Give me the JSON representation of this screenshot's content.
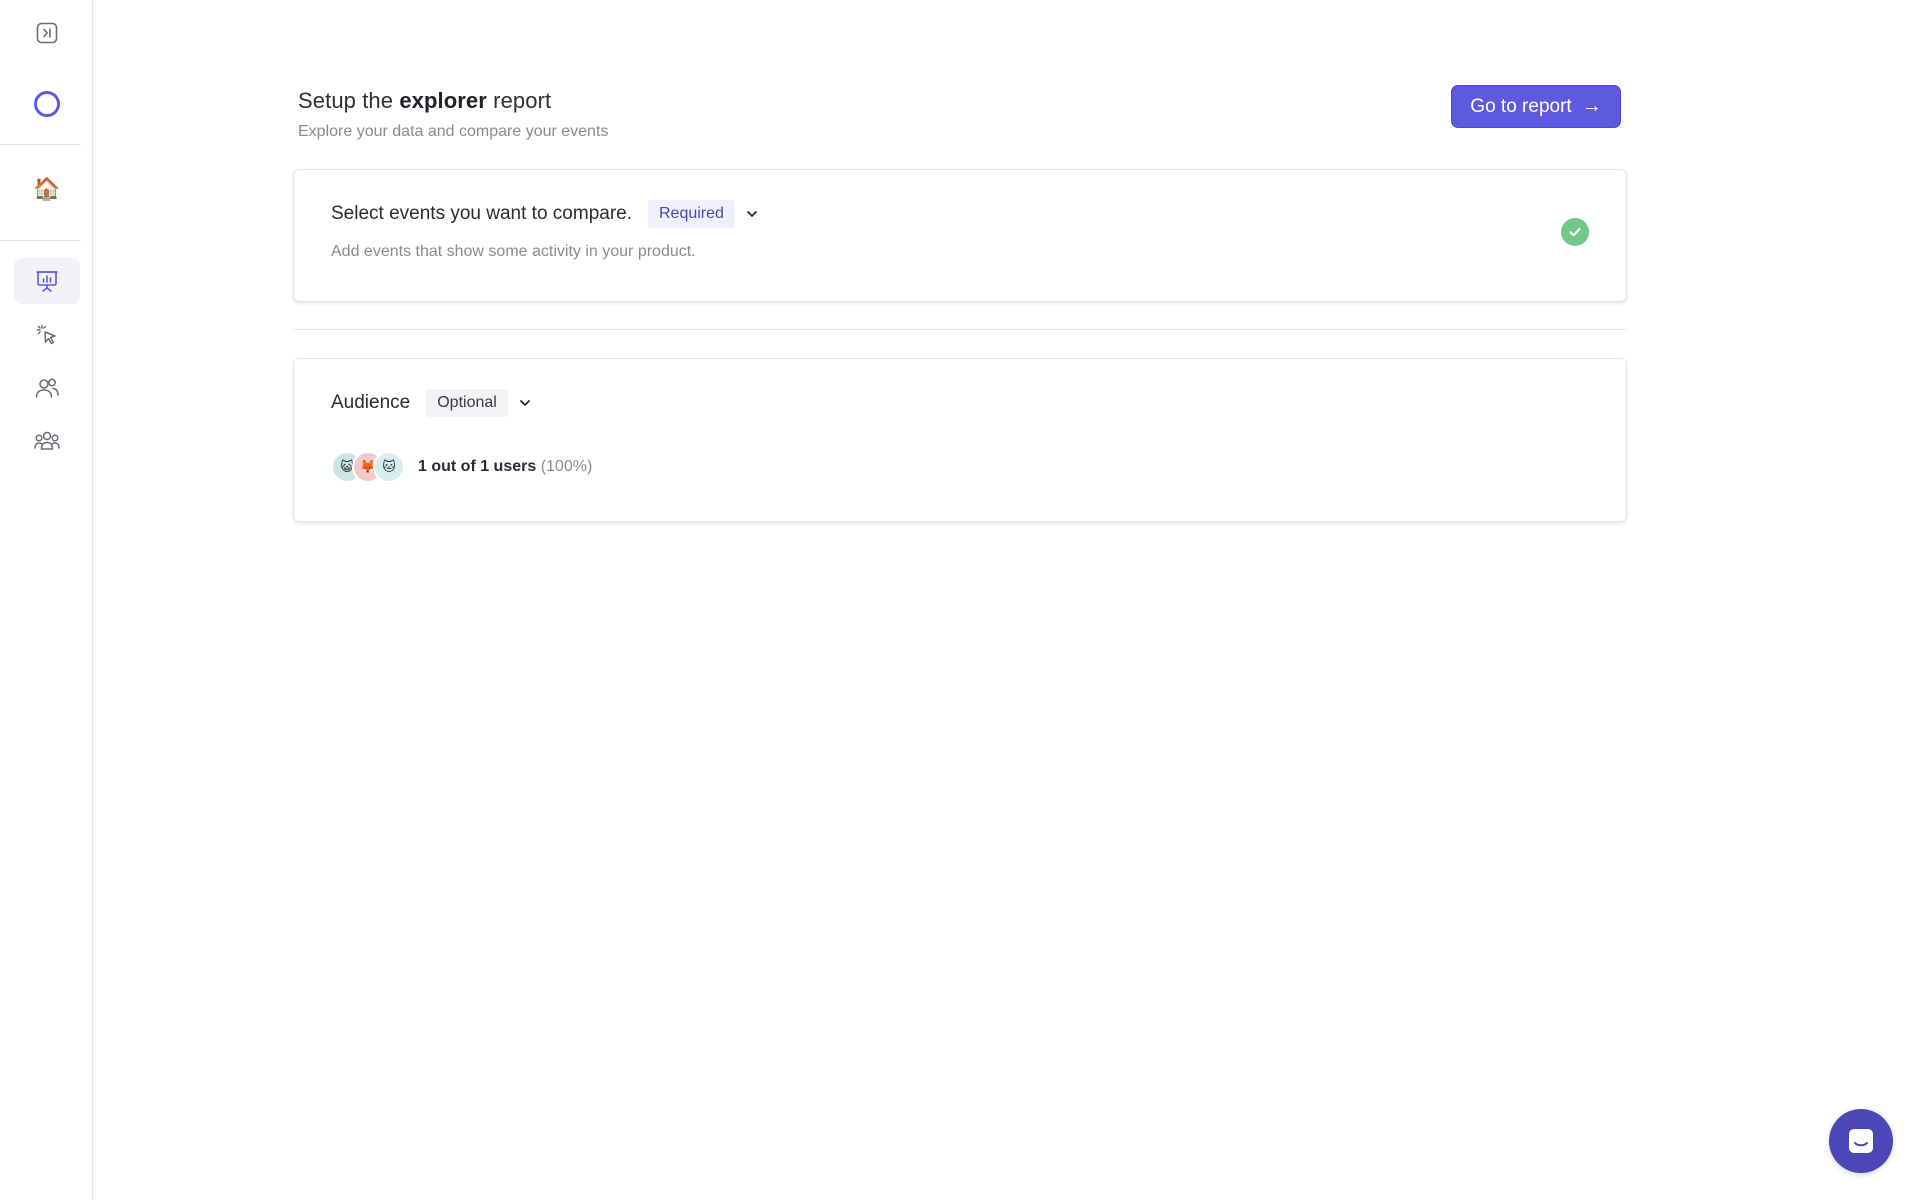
{
  "sidebar": {
    "items": [
      {
        "icon": "sidebar-expand-icon"
      },
      {
        "icon": "loading-ring-icon"
      },
      {
        "icon": "house-emoji-icon",
        "glyph": "🏠"
      },
      {
        "icon": "presentation-chart-icon"
      },
      {
        "icon": "click-pointer-icon"
      },
      {
        "icon": "users-icon"
      },
      {
        "icon": "groups-icon"
      }
    ]
  },
  "header": {
    "title_prefix": "Setup the",
    "title_bold": "explorer",
    "title_suffix": "report",
    "subtitle": "Explore your data and compare your events",
    "go_label": "Go to report",
    "go_arrow": "→"
  },
  "events_card": {
    "title": "Select events you want to compare.",
    "badge": "Required",
    "description": "Add events that show some activity in your product."
  },
  "audience_card": {
    "title": "Audience",
    "badge": "Optional",
    "avatars": [
      "😺",
      "🦊",
      "🐱"
    ],
    "count_text": "1 out of 1 users",
    "percent_text": "(100%)"
  },
  "colors": {
    "accent": "#5d5ae0",
    "success": "#72c889",
    "chat": "#4b47b8"
  }
}
